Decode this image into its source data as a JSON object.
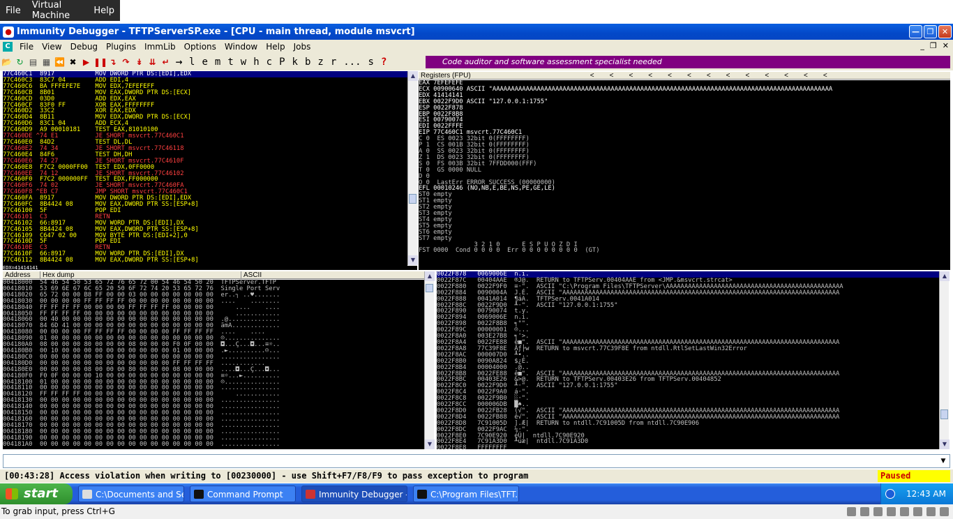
{
  "vm_menu": [
    "File",
    "Virtual Machine",
    "Help"
  ],
  "window_title": "Immunity Debugger - TFTPServerSP.exe - [CPU - main thread, module msvcrt]",
  "menu": [
    "File",
    "View",
    "Debug",
    "Plugins",
    "ImmLib",
    "Options",
    "Window",
    "Help",
    "Jobs"
  ],
  "toolbar_letters": [
    "l",
    "e",
    "m",
    "t",
    "w",
    "h",
    "c",
    "P",
    "k",
    "b",
    "z",
    "r",
    "...",
    "s",
    "?"
  ],
  "banner": "Code auditor and software assessment specialist needed",
  "cpu_lines": [
    "77C460C1  8917           MOV DWORD PTR DS:[EDI],EDX",
    "77C460C3  83C7 04        ADD EDI,4",
    "77C460C6  BA FFFEFE7E    MOV EDX,7EFEFEFF",
    "77C460CB  8B01           MOV EAX,DWORD PTR DS:[ECX]",
    "77C460CD  03D0           ADD EDX,EAX",
    "77C460CF  83F0 FF        XOR EAX,FFFFFFFF",
    "77C460D2  33C2           XOR EAX,EDX",
    "77C460D4  8B11           MOV EDX,DWORD PTR DS:[ECX]",
    "77C460D6  83C1 04        ADD ECX,4",
    "77C460D9  A9 00010181    TEST EAX,81010100",
    "77C460DE ^74 E1          JE SHORT msvcrt.77C460C1",
    "77C460E0  84D2           TEST DL,DL",
    "77C460E2  74 34          JE SHORT msvcrt.77C46118",
    "77C460E4  84F6           TEST DH,DH",
    "77C460E6  74 27          JE SHORT msvcrt.77C4610F",
    "77C460E8  F7C2 0000FF00  TEST EDX,0FF0000",
    "77C460EE  74 12          JE SHORT msvcrt.77C46102",
    "77C460F0  F7C2 000000FF  TEST EDX,FF000000",
    "77C460F6  74 02          JE SHORT msvcrt.77C460FA",
    "77C460F8 ^EB C7          JMP SHORT msvcrt.77C460C1",
    "77C460FA  8917           MOV DWORD PTR DS:[EDI],EDX",
    "77C460FC  8B4424 08      MOV EAX,DWORD PTR SS:[ESP+8]",
    "77C46100  5F             POP EDI",
    "77C46101  C3             RETN",
    "77C46102  66:8917        MOV WORD PTR DS:[EDI],DX",
    "77C46105  8B4424 08      MOV EAX,DWORD PTR SS:[ESP+8]",
    "77C46109  C647 02 00     MOV BYTE PTR DS:[EDI+2],0",
    "77C4610D  5F             POP EDI",
    "77C4610E  C3             RETN",
    "77C4610F  66:8917        MOV WORD PTR DS:[EDI],DX",
    "77C46112  8B4424 08      MOV EAX,DWORD PTR SS:[ESP+8]"
  ],
  "cpu_info": "EDX=41414141",
  "registers_title": "Registers (FPU)",
  "registers": [
    "EAX 7EFEFEFE",
    "ECX 00900640 ASCII \"AAAAAAAAAAAAAAAAAAAAAAAAAAAAAAAAAAAAAAAAAAAAAAAAAAAAAAAAAAAAAAAAAAAAAAAAAAAAAAAAAAAAAAAAAAAA",
    "EDX 41414141",
    "EBX 0022F9D0 ASCII \"127.0.0.1:1755\"",
    "ESP 0022F878",
    "EBP 0022F8B8",
    "ESI 00790074",
    "EDI 0022FFFE",
    "",
    "EIP 77C460C1 msvcrt.77C460C1",
    "",
    "C 0  ES 0023 32bit 0(FFFFFFFF)",
    "P 1  CS 001B 32bit 0(FFFFFFFF)",
    "A 0  SS 0023 32bit 0(FFFFFFFF)",
    "Z 1  DS 0023 32bit 0(FFFFFFFF)",
    "S 0  FS 003B 32bit 7FFDD000(FFF)",
    "T 0  GS 0000 NULL",
    "D 0",
    "O 0  LastErr ERROR_SUCCESS (00000000)",
    "",
    "EFL 00010246 (NO,NB,E,BE,NS,PE,GE,LE)",
    "",
    "ST0 empty",
    "ST1 empty",
    "ST2 empty",
    "ST3 empty",
    "ST4 empty",
    "ST5 empty",
    "ST6 empty",
    "ST7 empty",
    "               3 2 1 0      E S P U O Z D I",
    "FST 0000  Cond 0 0 0 0  Err 0 0 0 0 0 0 0 0  (GT)"
  ],
  "dump_headers": [
    "Address",
    "Hex dump",
    "ASCII"
  ],
  "dump_lines": [
    "00418000  54 46 54 50 53 65 72 76 65 72 00 54 46 54 50 20  TFTPServer.TFTP ",
    "00418010  53 69 6E 67 6C 65 20 50 6F 72 74 20 53 65 72 76  Single Port Serv",
    "00418020  65 72 00 00 B8 FF 00 00 03 00 00 00 00 00 00 00  er..┐ ..♥.......",
    "00418030  00 00 00 00 FF FF FF FF 00 00 00 00 00 00 00 00  ....    ........",
    "00418040  FF FF FF FF 00 00 00 00 FF FF FF FF 00 00 00 00      ....    ....",
    "00418050  FF FF FF FF 00 00 00 00 00 00 00 00 00 00 00 00      ............",
    "00418060  00 40 00 00 00 00 00 00 00 00 00 00 00 00 00 00  .@..............",
    "00418070  84 6D 41 00 00 00 00 00 00 00 00 00 00 00 00 00  ämA.............",
    "00418080  00 00 00 00 FF FF FF FF 00 00 00 00 FF FF FF FF  ....    ....    ",
    "00418090  01 00 00 00 00 00 00 00 00 00 00 00 00 00 00 00  ☺...............",
    "004180A0  08 00 00 00 80 00 00 00 08 00 00 00 F0 0F 00 00  ◘...Ç...◘...≡☼..",
    "004180B0  00 10 00 00 00 00 00 00 00 00 00 00 01 00 00 00  .►..........☺...",
    "004180C0  00 00 00 00 00 00 00 00 00 00 00 00 00 00 00 00  ................",
    "004180D0  00 00 00 00 00 00 00 00 00 00 00 00 FF FF FF FF  ............    ",
    "004180E0  00 00 00 00 08 00 00 00 80 00 00 00 08 00 00 00  ....◘...Ç...◘...",
    "004180F0  F0 0F 00 00 00 10 00 00 00 00 00 00 00 00 00 00  ≡☼...►..........",
    "00418100  01 00 00 00 00 00 00 00 00 00 00 00 00 00 00 00  ☺...............",
    "00418110  00 00 00 00 00 00 00 00 00 00 00 00 00 00 00 00  ................",
    "00418120  FF FF FF FF 00 00 00 00 00 00 00 00 00 00 00 00      ............",
    "00418130  00 00 00 00 00 00 00 00 00 00 00 00 00 00 00 00  ................",
    "00418140  00 00 00 00 00 00 00 00 00 00 00 00 00 00 00 00  ................",
    "00418150  00 00 00 00 00 00 00 00 00 00 00 00 00 00 00 00  ................",
    "00418160  00 00 00 00 00 00 00 00 00 00 00 00 00 00 00 00  ................",
    "00418170  00 00 00 00 00 00 00 00 00 00 00 00 00 00 00 00  ................",
    "00418180  00 00 00 00 00 00 00 00 00 00 00 00 00 00 00 00  ................",
    "00418190  00 00 00 00 00 00 00 00 00 00 00 00 00 00 00 00  ................",
    "004181A0  00 00 00 00 00 00 00 00 00 00 00 00 00 00 00 00  ................"
  ],
  "stack_lines": [
    "0022F878   0069006E  n.i.",
    "0022F87C   00404AAE  ®J@.  RETURN to TFTPServ.00404AAE from <JMP.&msvcrt.strcat>",
    "0022F880   0022F9F0  ≡·\".  ASCII \"C:\\Program Files\\TFTPServer\\AAAAAAAAAAAAAAAAAAAAAAAAAAAAAAAAAAAAAAAAAAAAAAAA",
    "0022F884   0090004A  J.É.  ASCII \"AAAAAAAAAAAAAAAAAAAAAAAAAAAAAAAAAAAAAAAAAAAAAAAAAAAAAAAAAAAAAAAAAAAAAAAAAAA",
    "0022F888   0041A014  ¶áA.  TFTPServ.0041A014",
    "0022F88C   0022F9D0  ╨·\".  ASCII \"127.0.0.1:1755\"",
    "0022F890   00790074  t.y.",
    "0022F894   0069006E  n.i.",
    "0022F898   0022F8B8  ╕°\".",
    "0022F89C   00000001  ☺...",
    "0022F8A0   003E27B8  ╕'>.",
    "0022F8A4   0022FE88  ê■\".  ASCII \"AAAAAAAAAAAAAAAAAAAAAAAAAAAAAAAAAAAAAAAAAAAAAAAAAAAAAAAAAAAAAAAAAAAAAAAAAAA",
    "0022F8A8   77C39F8E  Äƒ├w  RETURN to msvcrt.77C39F8E from ntdll.RtlSetLastWin32Error",
    "0022F8AC   000007D0  ╨•..",
    "0022F8B0   0090A824  $¿É.",
    "0022F8B4   00004000  .@..",
    "0022F8B8   0022FE88  ê■\".  ASCII \"AAAAAAAAAAAAAAAAAAAAAAAAAAAAAAAAAAAAAAAAAAAAAAAAAAAAAAAAAAAAAAAAAAAAAAAAAAA",
    "0022F8BC   00403E26  &>@.  RETURN to TFTPServ.00403E26 from TFTPServ.00404852",
    "0022F8C0   0022F9D0  ╨·\".  ASCII \"127.0.0.1:1755\"",
    "0022F8C4   0022F9A0  á·\".",
    "0022F8C8   0022F9B0  ░·\".",
    "0022F8CC   000006DB  █♠..",
    "0022F8D0   0022FB28  (√\".  ASCII \"AAAAAAAAAAAAAAAAAAAAAAAAAAAAAAAAAAAAAAAAAAAAAAAAAAAAAAAAAAAAAAAAAAAAAAAAAAA",
    "0022F8D4   0022FB88  ê√\".  ASCII \"AAAAAAAAAAAAAAAAAAAAAAAAAAAAAAAAAAAAAAAAAAAAAAAAAAAAAAAAAAAAAAAAAAAAAAAAAAA",
    "0022F8D8   7C91005D  ].Æ|  RETURN to ntdll.7C91005D from ntdll.7C90E906",
    "0022F8DC   0022F9AC  ¼·\".",
    "0022F8E0   7C90E920  éÚ|  ntdll.7C90E920",
    "0022F8E4   7C91A3D0  ╨úæ|  ntdll.7C91A3D0",
    "0022F8E8   FFFFFFFF"
  ],
  "status_message": "[00:43:28] Access violation when writing to [00230000] - use Shift+F7/F8/F9 to pass exception to program",
  "status_state": "Paused",
  "start_label": "start",
  "tasks": [
    "C:\\Documents and Se...",
    "Command Prompt",
    "Immunity Debugger - ...",
    "C:\\Program Files\\TFT..."
  ],
  "clock": "12:43 AM",
  "vm_status": "To grab input, press Ctrl+G"
}
